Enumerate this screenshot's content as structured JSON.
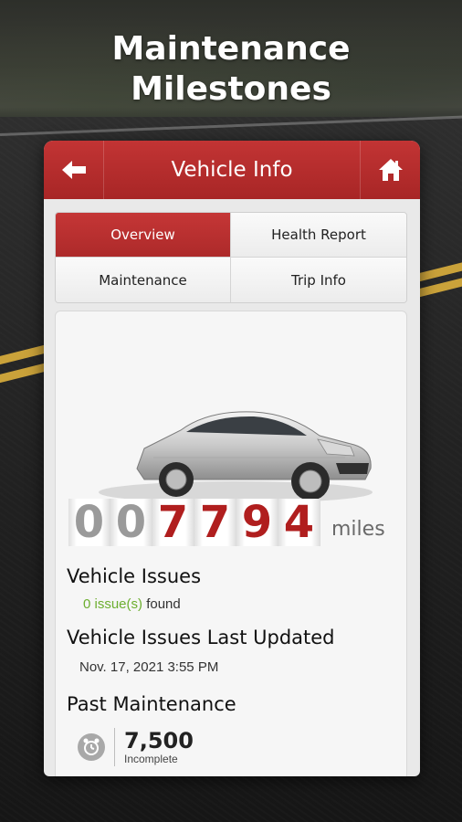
{
  "headline": {
    "line1": "Maintenance",
    "line2": "Milestones"
  },
  "header": {
    "title": "Vehicle Info"
  },
  "tabs": [
    {
      "label": "Overview",
      "active": true
    },
    {
      "label": "Health Report",
      "active": false
    },
    {
      "label": "Maintenance",
      "active": false
    },
    {
      "label": "Trip Info",
      "active": false
    }
  ],
  "odometer": {
    "digits": [
      "0",
      "0",
      "7",
      "7",
      "9",
      "4"
    ],
    "unit": "miles"
  },
  "issues": {
    "heading": "Vehicle Issues",
    "count": "0 issue(s)",
    "suffix": "found"
  },
  "last_updated": {
    "heading": "Vehicle Issues Last Updated",
    "value": "Nov. 17, 2021 3:55 PM"
  },
  "past_maintenance": {
    "heading": "Past Maintenance",
    "mileage": "7,500",
    "status": "Incomplete"
  },
  "colors": {
    "header_red": "#b22b2b",
    "issue_green": "#6cae2f",
    "odometer_red": "#b01e1e"
  },
  "icons": {
    "back": "arrow-left-icon",
    "home": "home-icon",
    "maintenance": "alarm-clock-icon"
  }
}
